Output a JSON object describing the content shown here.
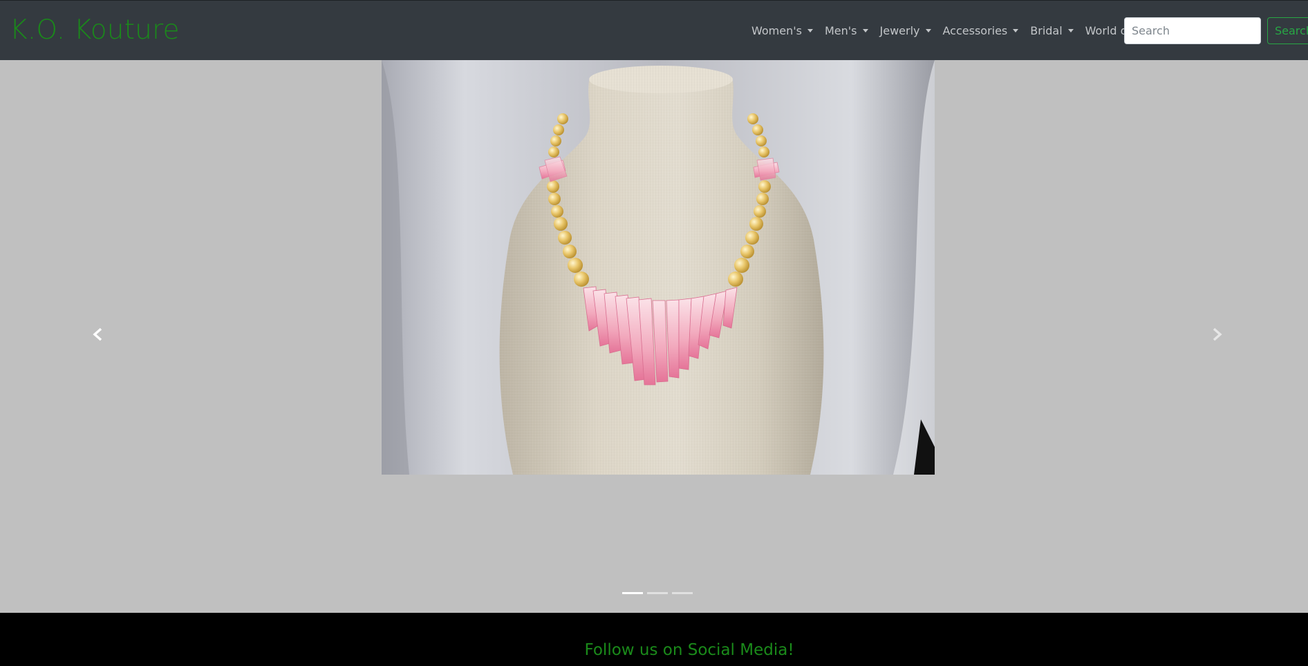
{
  "brand": {
    "name": "K.O. Kouture"
  },
  "nav": {
    "items": [
      {
        "label": "Women's"
      },
      {
        "label": "Men's"
      },
      {
        "label": "Jewerly"
      },
      {
        "label": "Accessories"
      },
      {
        "label": "Bridal"
      },
      {
        "label": "World of"
      }
    ],
    "search_placeholder": "Search",
    "search_button": "Search"
  },
  "carousel": {
    "image_subject": "necklace-on-linen-bust",
    "slide_count": 3,
    "active_index": 0
  },
  "footer": {
    "title": "Follow us on Social Media!"
  },
  "colors": {
    "brand_green": "#1a8a1a",
    "navbar": "#343a40",
    "search_green": "#28a745",
    "page_bg": "#c0c0c0"
  }
}
